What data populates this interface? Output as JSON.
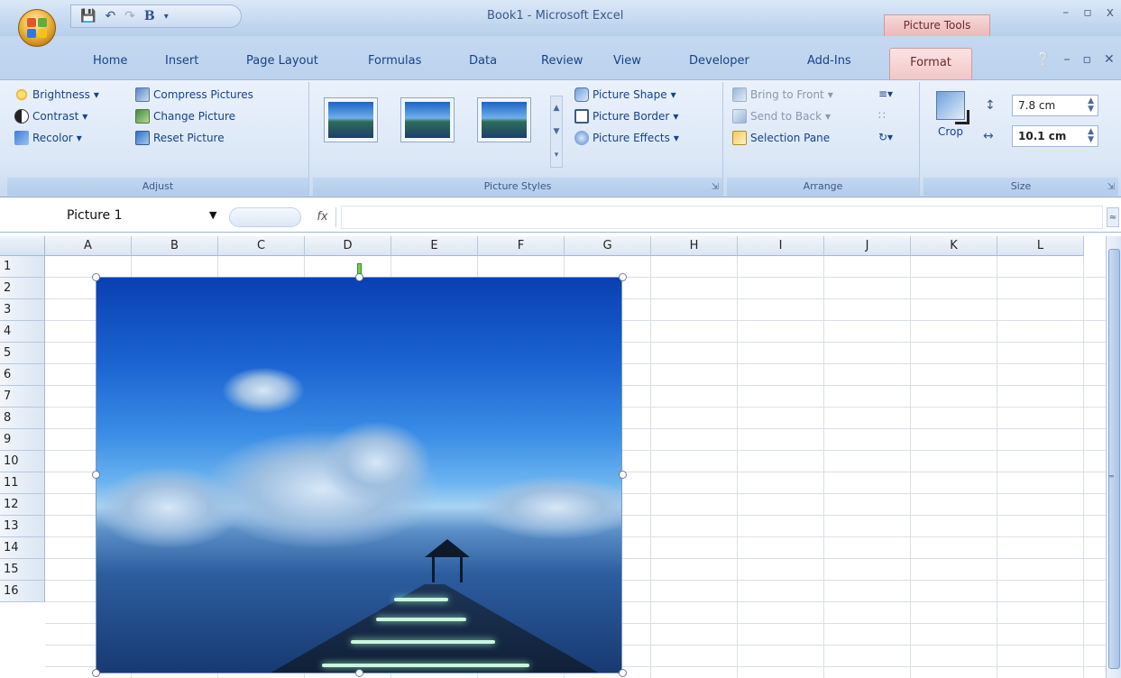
{
  "window": {
    "title": "Book1 - Microsoft Excel",
    "contextual_tab_group": "Picture Tools",
    "controls": [
      "–",
      "▫",
      "x"
    ]
  },
  "qat": {
    "icons": [
      "save-icon",
      "undo-icon",
      "redo-icon",
      "bold-icon",
      "customize-icon"
    ]
  },
  "tabs": [
    "Home",
    "Insert",
    "Page Layout",
    "Formulas",
    "Data",
    "Review",
    "View",
    "Developer",
    "Add-Ins",
    "Format"
  ],
  "ribbon": {
    "adjust": {
      "label": "Adjust",
      "brightness": "Brightness",
      "contrast": "Contrast",
      "recolor": "Recolor",
      "compress": "Compress Pictures",
      "change": "Change Picture",
      "reset": "Reset Picture"
    },
    "picture_styles": {
      "label": "Picture Styles",
      "shape": "Picture Shape",
      "border": "Picture Border",
      "effects": "Picture Effects"
    },
    "arrange": {
      "label": "Arrange",
      "bring_front": "Bring to Front",
      "send_back": "Send to Back",
      "selection_pane": "Selection Pane"
    },
    "size": {
      "label": "Size",
      "crop": "Crop",
      "height": "7.8 cm",
      "width": "10.1 cm"
    }
  },
  "formula_bar": {
    "name_box": "Picture 1",
    "fx": "fx",
    "value": ""
  },
  "sheet": {
    "columns": [
      "A",
      "B",
      "C",
      "D",
      "E",
      "F",
      "G",
      "H",
      "I",
      "J",
      "K",
      "L"
    ],
    "rows": [
      "1",
      "2",
      "3",
      "4",
      "5",
      "6",
      "7",
      "8",
      "9",
      "10",
      "11",
      "12",
      "13",
      "14",
      "15",
      "16"
    ],
    "selected_object": "Picture 1"
  },
  "colors": {
    "ribbon_bg": "#dbe7f6",
    "contextual_tab": "#f2c6c6",
    "accent_text": "#15428b"
  }
}
